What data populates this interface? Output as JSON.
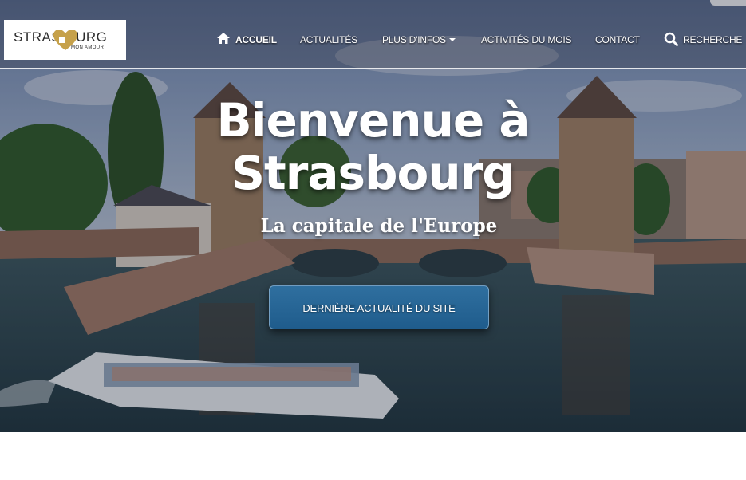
{
  "logo": {
    "word": "STRAS  OURG",
    "sub": "MON AMOUR",
    "heart_color": "#c6a14a"
  },
  "nav": {
    "home": "ACCUEIL",
    "news": "ACTUALITÉS",
    "more": "PLUS D'INFOS",
    "activities": "ACTIVITÉS DU MOIS",
    "contact": "CONTACT",
    "search": "RECHERCHE"
  },
  "hero": {
    "title_line1": "Bienvenue à",
    "title_line2": "Strasbourg",
    "subtitle": "La capitale de l'Europe",
    "cta": "DERNIÈRE ACTUALITÉ DU SITE",
    "cta_color": "#2a6a9a"
  },
  "icons": {
    "home": "home-icon",
    "search": "search-icon",
    "caret": "caret-down-icon"
  }
}
